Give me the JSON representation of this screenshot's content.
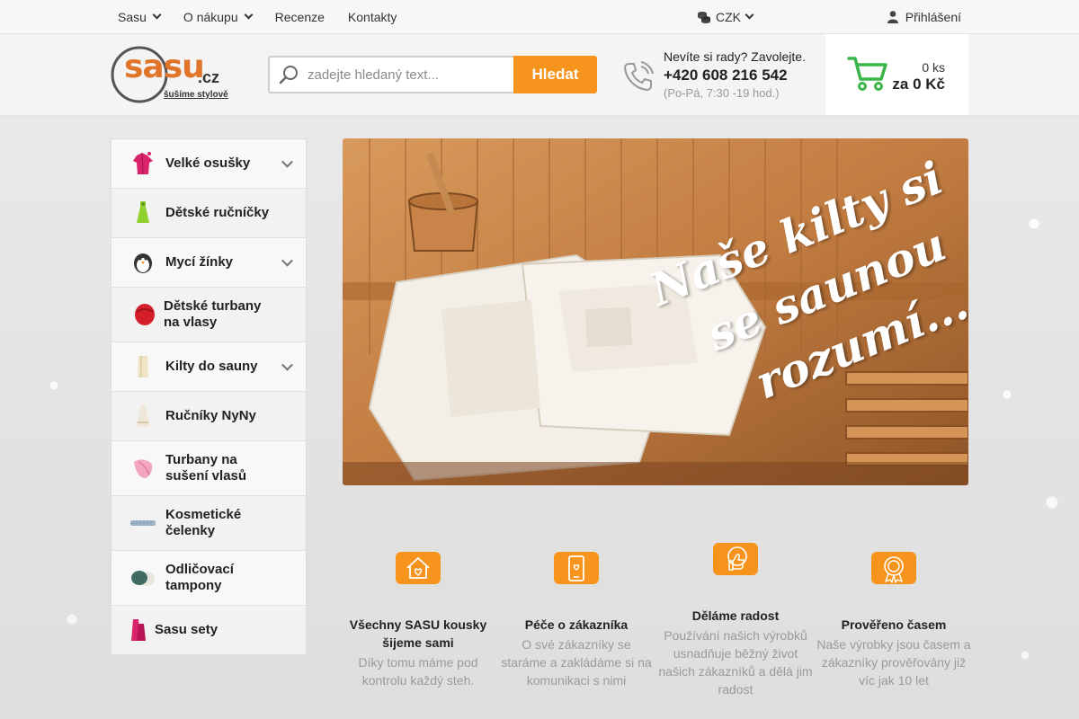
{
  "topbar": {
    "nav": [
      {
        "label": "Sasu",
        "dropdown": true
      },
      {
        "label": "O nákupu",
        "dropdown": true
      },
      {
        "label": "Recenze",
        "dropdown": false
      },
      {
        "label": "Kontakty",
        "dropdown": false
      }
    ],
    "currency": "CZK",
    "login": "Přihlášení"
  },
  "header": {
    "logo_text": "sasu",
    "logo_tld": ".cz",
    "logo_slogan": "šušíme stylově",
    "search_placeholder": "zadejte hledaný text...",
    "search_button": "Hledat",
    "phone_question": "Nevíte si rady? Zavolejte.",
    "phone_number": "+420 608 216 542",
    "phone_hours": "(Po-Pá, 7:30 -19 hod.)",
    "cart_count": "0 ks",
    "cart_total": "za 0 Kč"
  },
  "categories": [
    {
      "label": "Velké osušky",
      "icon": "bathrobe-icon",
      "dropdown": true
    },
    {
      "label": "Dětské ručníčky",
      "icon": "kids-towel-icon",
      "dropdown": false
    },
    {
      "label": "Mycí žínky",
      "icon": "penguin-mitt-icon",
      "dropdown": true
    },
    {
      "label": "Dětské turbany na vlasy",
      "icon": "kids-turban-icon",
      "dropdown": false
    },
    {
      "label": "Kilty do sauny",
      "icon": "sauna-kilt-icon",
      "dropdown": true
    },
    {
      "label": "Ručníky NyNy",
      "icon": "nyny-towel-icon",
      "dropdown": false
    },
    {
      "label": "Turbany na sušení vlasů",
      "icon": "hair-turban-icon",
      "dropdown": false
    },
    {
      "label": "Kosmetické čelenky",
      "icon": "headband-icon",
      "dropdown": false
    },
    {
      "label": "Odličovací tampony",
      "icon": "cotton-pads-icon",
      "dropdown": false
    },
    {
      "label": "Sasu sety",
      "icon": "sets-icon",
      "dropdown": false
    }
  ],
  "banner": {
    "line1": "Naše kilty si",
    "line2": "se saunou",
    "line3": "rozumí..."
  },
  "features": [
    {
      "icon": "home-heart-icon",
      "title": "Všechny SASU kousky šijeme sami",
      "desc": "Díky tomu máme pod kontrolu každý steh."
    },
    {
      "icon": "phone-heart-icon",
      "title": "Péče o zákazníka",
      "desc": "O své zákazníky se staráme a zakládáme si na komunikaci s nimi"
    },
    {
      "icon": "thumbs-up-icon",
      "title": "Děláme radost",
      "desc": "Používání našich výrobků usnadňuje běžný život našich zákazníků a dělá jim radost"
    },
    {
      "icon": "award-icon",
      "title": "Prověřeno časem",
      "desc": "Naše výrobky jsou časem a zákazníky prověřovány již víc jak 10 let"
    }
  ],
  "colors": {
    "accent": "#f7941d",
    "cart_green": "#3bb54a",
    "logo_orange": "#f47c20"
  }
}
